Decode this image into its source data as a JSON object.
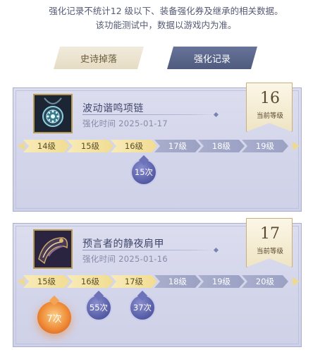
{
  "notice": {
    "line1": "强化记录不统计12 级以下、装备强化券及继承的相关数据。",
    "line2": "该功能测试中，数据以游戏内为准。"
  },
  "tabs": [
    {
      "label": "史诗掉落",
      "active": false
    },
    {
      "label": "强化记录",
      "active": true
    }
  ],
  "colors": {
    "accent": "#55608a",
    "track_filled": "#f1dc92",
    "track_empty": "#a3a8c8",
    "drop_blue": "#5a60a8",
    "drop_orange": "#ef8b36"
  },
  "records": [
    {
      "icon": "necklace-icon",
      "name": "波动谐鸣项链",
      "date": "强化时间  2025-01-17",
      "level": "16",
      "level_label": "当前等级",
      "levels": [
        "14级",
        "15级",
        "16级",
        "17级",
        "18级",
        "19级"
      ],
      "filled_count": 3,
      "counts": [
        {
          "level_index": 2,
          "label": "15次",
          "style": "blue"
        }
      ]
    },
    {
      "icon": "shoulder-armor-icon",
      "name": "预言者的静夜肩甲",
      "date": "强化时间  2025-01-16",
      "level": "17",
      "level_label": "当前等级",
      "levels": [
        "15级",
        "16级",
        "17级",
        "18级",
        "19级",
        "20级"
      ],
      "filled_count": 3,
      "counts": [
        {
          "level_index": 0,
          "label": "7次",
          "style": "orange"
        },
        {
          "level_index": 1,
          "label": "55次",
          "style": "blue"
        },
        {
          "level_index": 2,
          "label": "37次",
          "style": "blue"
        }
      ]
    }
  ]
}
